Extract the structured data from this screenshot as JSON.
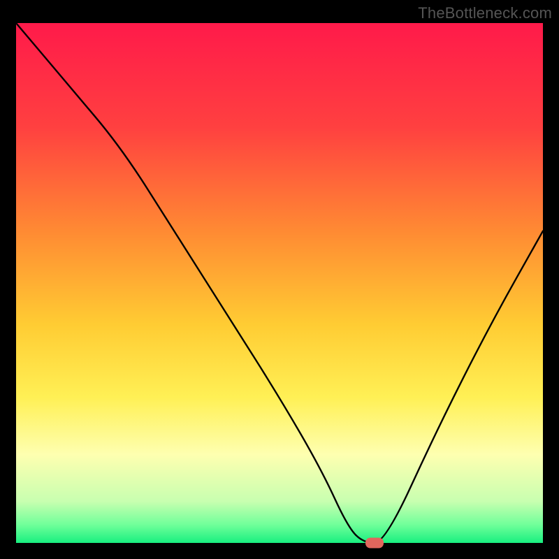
{
  "watermark": "TheBottleneck.com",
  "colors": {
    "black": "#000000",
    "top": "#ff1a4a",
    "mid_upper": "#ff7a33",
    "mid": "#ffcc33",
    "mid_lower": "#ffee55",
    "pale_yellow": "#feffb0",
    "pale_green": "#b8ffb0",
    "green": "#18ef80",
    "marker": "#e2665d"
  },
  "chart_data": {
    "type": "line",
    "title": "",
    "xlabel": "",
    "ylabel": "",
    "xlim": [
      0,
      100
    ],
    "ylim": [
      0,
      100
    ],
    "x": [
      0,
      10,
      20,
      30,
      40,
      50,
      58,
      63,
      66,
      70,
      80,
      90,
      100
    ],
    "values": [
      100,
      88,
      76,
      60,
      44,
      28,
      14,
      3,
      0,
      0,
      22,
      42,
      60
    ],
    "marker": {
      "x": 68,
      "y": 0
    },
    "gradient_stops": [
      {
        "pos": 0.0,
        "color": "#ff1a4a"
      },
      {
        "pos": 0.2,
        "color": "#ff4040"
      },
      {
        "pos": 0.4,
        "color": "#ff8a33"
      },
      {
        "pos": 0.58,
        "color": "#ffcc33"
      },
      {
        "pos": 0.72,
        "color": "#fff055"
      },
      {
        "pos": 0.83,
        "color": "#feffb0"
      },
      {
        "pos": 0.92,
        "color": "#c8ffb0"
      },
      {
        "pos": 0.965,
        "color": "#70ff9a"
      },
      {
        "pos": 1.0,
        "color": "#18ef80"
      }
    ]
  }
}
